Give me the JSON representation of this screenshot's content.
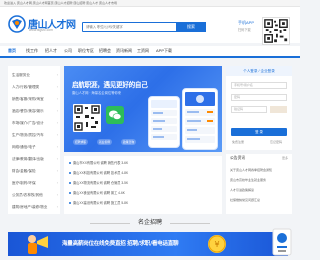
{
  "topbar": {
    "welcome": "欢迎进入 唐山人才网 唐山人才网首页 唐山人才招聘 唐山招聘 唐山人才 唐山人才市场"
  },
  "header": {
    "logo_name": "唐山人才网",
    "logo_url": "www.tsgsrc.com",
    "search_placeholder": "请输入 职位/公司/关键字",
    "search_button": "搜索",
    "app_title": "手机APP",
    "app_sub": "扫码下载"
  },
  "nav": {
    "items": [
      "首页",
      "找工作",
      "招人才",
      "公司",
      "职位专区",
      "招聘会",
      "资讯新闻",
      "工资网",
      "APP下载"
    ],
    "active_index": 0
  },
  "categories": [
    "生活服务业",
    "人力/行政/管理类",
    "销售/客服/采购/淘宝",
    "酒店/餐饮/美容/娱乐",
    "市场/媒介/广告/设计",
    "生产/物流/质控/汽车",
    "网络/通信/电子",
    "法律/教育/翻译/出版",
    "财会/金融/保险",
    "医疗/制药/环保",
    "公务员/农林牧/其他",
    "建筑/房地产/装修/物业"
  ],
  "banner": {
    "title": "启航职涯，遇见更好的自己",
    "subtitle": "唐山人才网 · 海量名企岗位等你来",
    "tags": [
      "招聘求职",
      "就业指导",
      "政策咨询"
    ]
  },
  "login": {
    "head": "个人登录 / 企业登录",
    "user_placeholder": "手机号/用户名",
    "pass_placeholder": "密码",
    "code_placeholder": "验证码",
    "button": "登 录",
    "register": "免费注册",
    "forgot": "忘记密码"
  },
  "strip": [
    "唐山市XX有限公司 诚聘 销售代表 3-6K",
    "唐山XX科技有限公司 诚聘 技术员 4-8K",
    "唐山XX物流有限公司 诚聘 仓管员 3-5K",
    "唐山XX食品有限公司 诚聘 普工 4-6K",
    "唐山XX建设有限公司 诚聘 施工员 5-8K"
  ],
  "notices": {
    "title": "公告资讯",
    "more": "更多",
    "items": [
      "关于唐山人才网春季招聘会通知",
      "唐山市高校毕业生就业服务",
      "人才引进政策解读",
      "社保缴纳常见问题汇总"
    ]
  },
  "section": {
    "famous": "名企招聘"
  },
  "bottom_banner": {
    "text": "海量高薪岗位在线免费直招 招聘/求职/看电话直聊"
  },
  "colors": {
    "brand": "#1a6fd8",
    "accent": "#ffd23f"
  }
}
